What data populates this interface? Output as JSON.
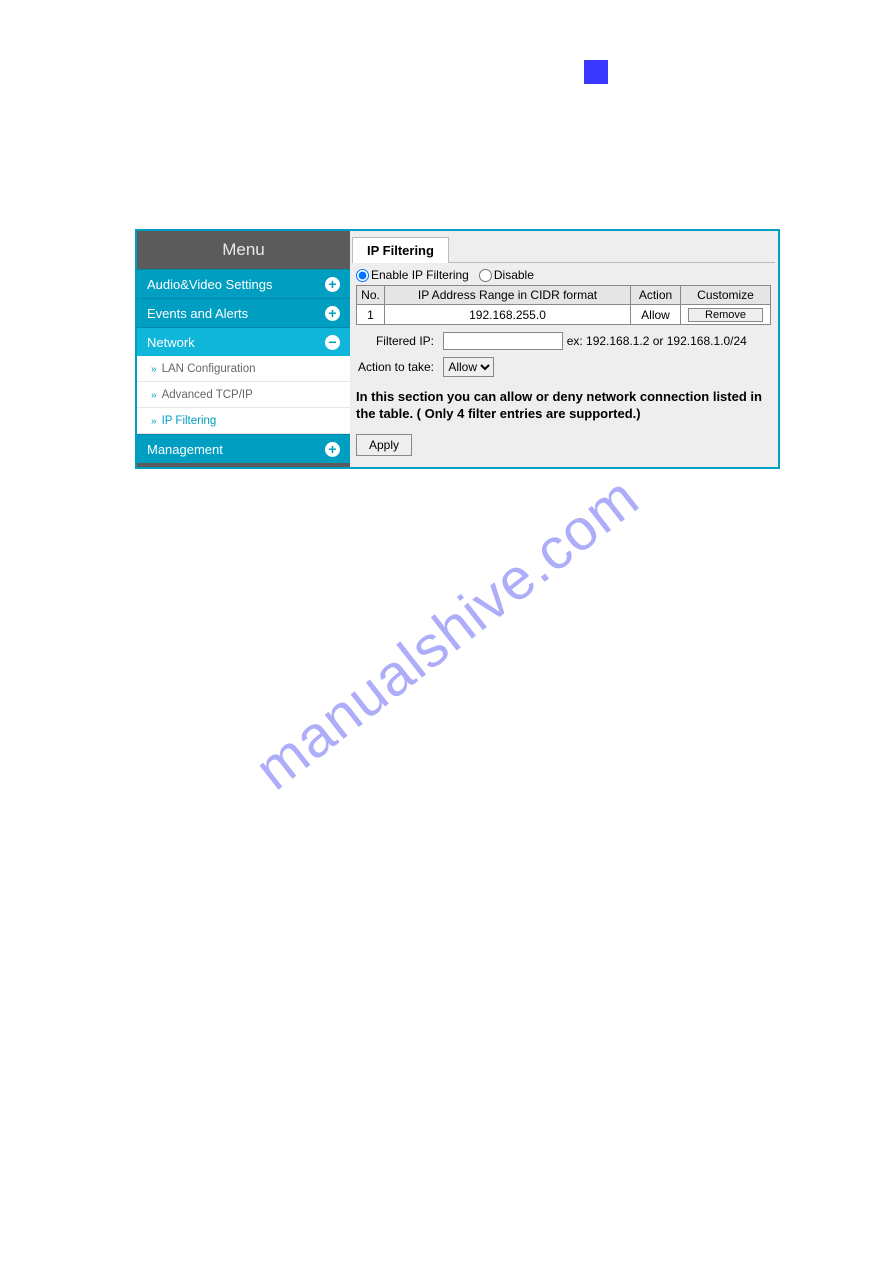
{
  "decor": {
    "watermark": "manualshive.com"
  },
  "sidebar": {
    "title": "Menu",
    "items": [
      {
        "label": "Audio&Video Settings",
        "expanded": false
      },
      {
        "label": "Events and Alerts",
        "expanded": false
      },
      {
        "label": "Network",
        "expanded": true
      },
      {
        "label": "Management",
        "expanded": false
      }
    ],
    "network_sub": [
      {
        "label": "LAN Configuration",
        "active": false
      },
      {
        "label": "Advanced TCP/IP",
        "active": false
      },
      {
        "label": "IP Filtering",
        "active": true
      }
    ]
  },
  "content": {
    "tab_label": "IP Filtering",
    "radio_enable": "Enable IP Filtering",
    "radio_disable": "Disable",
    "table": {
      "headers": {
        "no": "No.",
        "range": "IP Address Range in CIDR format",
        "action": "Action",
        "customize": "Customize"
      },
      "rows": [
        {
          "no": "1",
          "range": "192.168.255.0",
          "action": "Allow",
          "btn": "Remove"
        }
      ]
    },
    "filtered_ip_label": "Filtered IP:",
    "filtered_ip_value": "",
    "filtered_ip_hint": "ex: 192.168.1.2 or 192.168.1.0/24",
    "action_label": "Action to take:",
    "action_select": "Allow",
    "note": "In this section you can allow or deny network connection listed in the table. ( Only 4 filter entries are supported.)",
    "apply_label": "Apply"
  }
}
